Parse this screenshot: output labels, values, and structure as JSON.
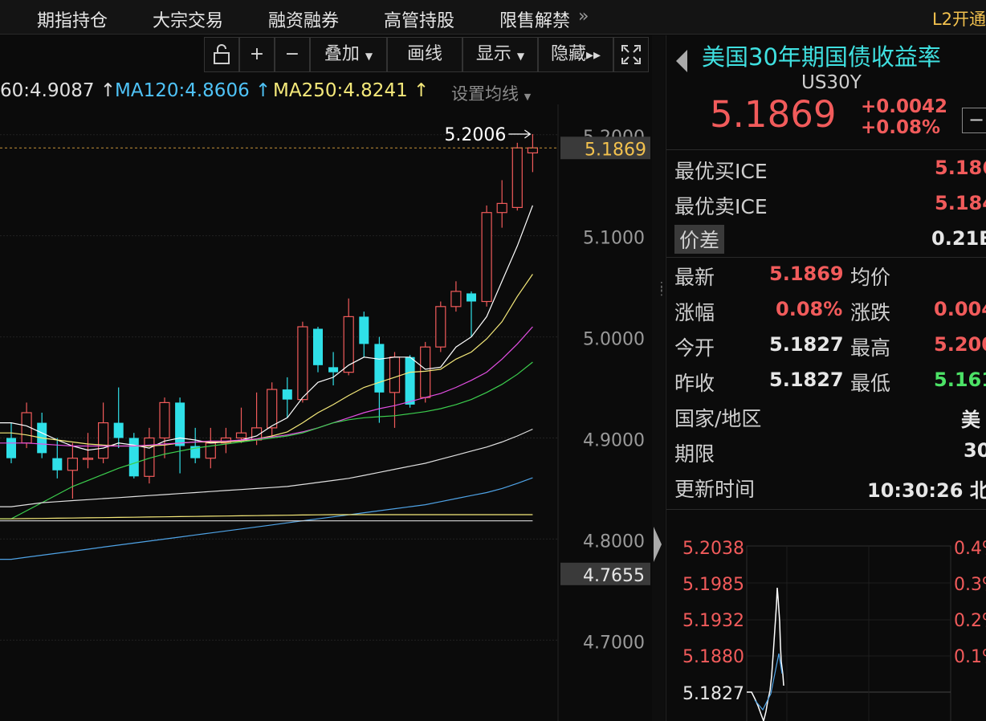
{
  "nav": {
    "items": [
      "期指持仓",
      "大宗交易",
      "融资融券",
      "高管持股",
      "限售解禁"
    ],
    "more": "»",
    "l2": "L2开通"
  },
  "toolbar": {
    "zoom_in": "+",
    "zoom_out": "−",
    "overlay": "叠加",
    "draw": "画线",
    "display": "显示",
    "hide": "隐藏"
  },
  "ma": {
    "ma60": "60:4.9087",
    "ma120": "MA120:4.8606",
    "ma250": "MA250:4.8241",
    "set_label": "设置均线"
  },
  "chart_data": {
    "type": "candlestick",
    "high_label": "5.2006",
    "current_price": "5.1869",
    "min_tag": "4.7655",
    "y_ticks": [
      "5.2000",
      "5.1000",
      "5.0000",
      "4.9000",
      "4.8000",
      "4.7000"
    ],
    "ylim": [
      4.62,
      5.23
    ],
    "candles": [
      {
        "o": 4.9,
        "c": 4.88,
        "h": 4.915,
        "l": 4.875
      },
      {
        "o": 4.895,
        "c": 4.925,
        "h": 4.935,
        "l": 4.89
      },
      {
        "o": 4.915,
        "c": 4.885,
        "h": 4.925,
        "l": 4.88
      },
      {
        "o": 4.88,
        "c": 4.868,
        "h": 4.9,
        "l": 4.86
      },
      {
        "o": 4.868,
        "c": 4.88,
        "h": 4.895,
        "l": 4.84
      },
      {
        "o": 4.88,
        "c": 4.88,
        "h": 4.905,
        "l": 4.87
      },
      {
        "o": 4.88,
        "c": 4.915,
        "h": 4.935,
        "l": 4.875
      },
      {
        "o": 4.915,
        "c": 4.9,
        "h": 4.95,
        "l": 4.89
      },
      {
        "o": 4.9,
        "c": 4.862,
        "h": 4.905,
        "l": 4.86
      },
      {
        "o": 4.862,
        "c": 4.9,
        "h": 4.91,
        "l": 4.855
      },
      {
        "o": 4.9,
        "c": 4.935,
        "h": 4.94,
        "l": 4.88
      },
      {
        "o": 4.935,
        "c": 4.892,
        "h": 4.94,
        "l": 4.865
      },
      {
        "o": 4.892,
        "c": 4.88,
        "h": 4.91,
        "l": 4.875
      },
      {
        "o": 4.88,
        "c": 4.895,
        "h": 4.91,
        "l": 4.87
      },
      {
        "o": 4.895,
        "c": 4.9,
        "h": 4.91,
        "l": 4.885
      },
      {
        "o": 4.9,
        "c": 4.905,
        "h": 4.93,
        "l": 4.895
      },
      {
        "o": 4.898,
        "c": 4.91,
        "h": 4.945,
        "l": 4.893
      },
      {
        "o": 4.91,
        "c": 4.948,
        "h": 4.955,
        "l": 4.9
      },
      {
        "o": 4.948,
        "c": 4.938,
        "h": 4.96,
        "l": 4.92
      },
      {
        "o": 4.938,
        "c": 5.01,
        "h": 5.015,
        "l": 4.935
      },
      {
        "o": 5.008,
        "c": 4.972,
        "h": 5.01,
        "l": 4.965
      },
      {
        "o": 4.97,
        "c": 4.965,
        "h": 4.985,
        "l": 4.952
      },
      {
        "o": 4.965,
        "c": 5.02,
        "h": 5.038,
        "l": 4.962
      },
      {
        "o": 5.02,
        "c": 4.993,
        "h": 5.025,
        "l": 4.98
      },
      {
        "o": 4.993,
        "c": 4.945,
        "h": 5.0,
        "l": 4.915
      },
      {
        "o": 4.945,
        "c": 4.98,
        "h": 4.985,
        "l": 4.91
      },
      {
        "o": 4.98,
        "c": 4.933,
        "h": 4.982,
        "l": 4.93
      },
      {
        "o": 4.94,
        "c": 4.99,
        "h": 4.995,
        "l": 4.935
      },
      {
        "o": 4.99,
        "c": 5.03,
        "h": 5.035,
        "l": 4.985
      },
      {
        "o": 5.03,
        "c": 5.045,
        "h": 5.055,
        "l": 5.025
      },
      {
        "o": 5.043,
        "c": 5.035,
        "h": 5.045,
        "l": 5.0
      },
      {
        "o": 5.035,
        "c": 5.123,
        "h": 5.13,
        "l": 5.03
      },
      {
        "o": 5.123,
        "c": 5.132,
        "h": 5.155,
        "l": 5.108
      },
      {
        "o": 5.128,
        "c": 5.187,
        "h": 5.192,
        "l": 5.125
      },
      {
        "o": 5.182,
        "c": 5.187,
        "h": 5.2006,
        "l": 5.163
      }
    ],
    "ma_lines": [
      {
        "name": "ma5",
        "color": "#ffffff",
        "values": [
          4.915,
          4.912,
          4.905,
          4.898,
          4.892,
          4.888,
          4.89,
          4.895,
          4.893,
          4.89,
          4.897,
          4.9,
          4.898,
          4.895,
          4.896,
          4.898,
          4.902,
          4.912,
          4.92,
          4.94,
          4.955,
          4.96,
          4.972,
          4.98,
          4.978,
          4.98,
          4.98,
          4.968,
          4.97,
          4.99,
          5.0,
          5.02,
          5.055,
          5.09,
          5.13
        ]
      },
      {
        "name": "ma10",
        "color": "#f5e97a",
        "values": [
          4.905,
          4.903,
          4.9,
          4.898,
          4.896,
          4.894,
          4.893,
          4.892,
          4.892,
          4.892,
          4.893,
          4.895,
          4.896,
          4.896,
          4.896,
          4.897,
          4.899,
          4.902,
          4.906,
          4.915,
          4.925,
          4.933,
          4.942,
          4.95,
          4.955,
          4.96,
          4.965,
          4.966,
          4.968,
          4.978,
          4.985,
          4.998,
          5.015,
          5.04,
          5.062
        ]
      },
      {
        "name": "ma20",
        "color": "#e24ee2",
        "values": [
          4.895,
          4.895,
          4.894,
          4.893,
          4.892,
          4.892,
          4.892,
          4.892,
          4.892,
          4.893,
          4.894,
          4.895,
          4.896,
          4.897,
          4.897,
          4.898,
          4.899,
          4.901,
          4.903,
          4.906,
          4.91,
          4.915,
          4.92,
          4.925,
          4.929,
          4.932,
          4.936,
          4.94,
          4.944,
          4.95,
          4.957,
          4.965,
          4.978,
          4.993,
          5.01
        ]
      },
      {
        "name": "ma30",
        "color": "#3ccf4e",
        "values": [
          4.82,
          4.828,
          4.836,
          4.844,
          4.852,
          4.858,
          4.864,
          4.87,
          4.875,
          4.88,
          4.884,
          4.887,
          4.89,
          4.892,
          4.894,
          4.896,
          4.898,
          4.9,
          4.902,
          4.905,
          4.91,
          4.915,
          4.918,
          4.92,
          4.921,
          4.922,
          4.924,
          4.926,
          4.929,
          4.933,
          4.938,
          4.945,
          4.953,
          4.963,
          4.975
        ]
      },
      {
        "name": "ma60",
        "color": "#e0e0e0",
        "values": [
          4.832,
          4.834,
          4.836,
          4.837,
          4.838,
          4.839,
          4.84,
          4.841,
          4.842,
          4.843,
          4.844,
          4.845,
          4.846,
          4.847,
          4.848,
          4.849,
          4.85,
          4.851,
          4.852,
          4.854,
          4.856,
          4.858,
          4.86,
          4.863,
          4.866,
          4.869,
          4.872,
          4.875,
          4.879,
          4.883,
          4.887,
          4.891,
          4.896,
          4.902,
          4.9087
        ]
      },
      {
        "name": "ma120",
        "color": "#4fa3e6",
        "values": [
          4.78,
          4.782,
          4.784,
          4.786,
          4.788,
          4.79,
          4.792,
          4.794,
          4.796,
          4.798,
          4.8,
          4.802,
          4.804,
          4.806,
          4.808,
          4.81,
          4.812,
          4.814,
          4.816,
          4.818,
          4.82,
          4.822,
          4.824,
          4.826,
          4.828,
          4.83,
          4.832,
          4.834,
          4.837,
          4.84,
          4.843,
          4.846,
          4.85,
          4.855,
          4.8606
        ]
      },
      {
        "name": "ma250",
        "color": "#f5e97a",
        "values": [
          4.82,
          4.8202,
          4.8204,
          4.8206,
          4.8208,
          4.821,
          4.8212,
          4.8214,
          4.8216,
          4.8218,
          4.822,
          4.8222,
          4.8224,
          4.8226,
          4.8228,
          4.823,
          4.8232,
          4.8234,
          4.8236,
          4.8238,
          4.824,
          4.8241,
          4.8241,
          4.8241,
          4.8241,
          4.8241,
          4.8241,
          4.8241,
          4.8241,
          4.8241,
          4.8241,
          4.8241,
          4.8241,
          4.8241,
          4.8241
        ]
      },
      {
        "name": "ma_white_low",
        "color": "#d8d8d8",
        "values": [
          4.818,
          4.818,
          4.818,
          4.818,
          4.818,
          4.818,
          4.818,
          4.818,
          4.818,
          4.818,
          4.818,
          4.818,
          4.818,
          4.818,
          4.818,
          4.818,
          4.818,
          4.818,
          4.818,
          4.818,
          4.818,
          4.818,
          4.818,
          4.818,
          4.818,
          4.818,
          4.818,
          4.818,
          4.818,
          4.818,
          4.818,
          4.818,
          4.818,
          4.818,
          4.818
        ]
      }
    ]
  },
  "quote": {
    "title": "美国30年期国债收益率",
    "code": "US30Y",
    "price": "5.1869",
    "change": "+0.0042",
    "change_pct": "+0.08%",
    "collapse": "−"
  },
  "book": {
    "bid_label": "最优买ICE",
    "bid_value": "5.186",
    "ask_label": "最优卖ICE",
    "ask_value": "5.184",
    "spread_label": "价差",
    "spread_value": "0.21B"
  },
  "stats": {
    "latest_label": "最新",
    "latest_value": "5.1869",
    "avg_label": "均价",
    "chg_pct_label": "涨幅",
    "chg_pct_value": "0.08%",
    "chg_label": "涨跌",
    "chg_value": "0.004",
    "open_label": "今开",
    "open_value": "5.1827",
    "high_label": "最高",
    "high_value": "5.200",
    "prev_label": "昨收",
    "prev_value": "5.1827",
    "low_label": "最低",
    "low_value": "5.161",
    "country_label": "国家/地区",
    "country_value": "美",
    "term_label": "期限",
    "term_value": "30",
    "update_label": "更新时间",
    "update_value": "10:30:26 北"
  },
  "mini": {
    "y_labels": [
      "5.2038",
      "5.1985",
      "5.1932",
      "5.1880",
      "5.1827"
    ],
    "pct_labels": [
      "0.4%",
      "0.3%",
      "0.2%",
      "0.1%"
    ]
  }
}
